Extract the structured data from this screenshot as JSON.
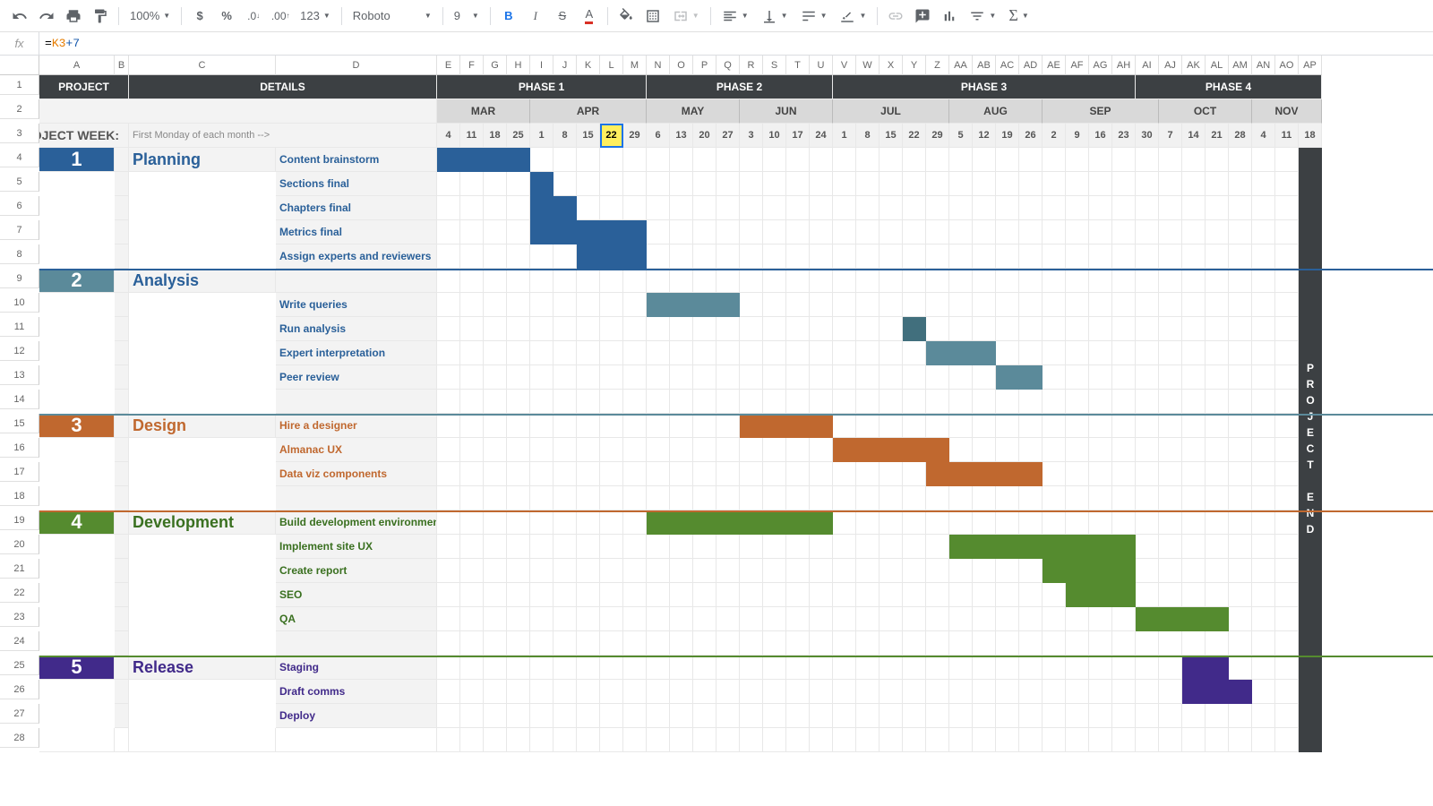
{
  "toolbar": {
    "zoom": "100%",
    "format_options": [
      "$",
      "%",
      ".0",
      ".00",
      "123"
    ],
    "font": "Roboto",
    "font_size": "9"
  },
  "formula": "=K3+7",
  "columns": [
    "A",
    "B",
    "C",
    "D",
    "E",
    "F",
    "G",
    "H",
    "I",
    "J",
    "K",
    "L",
    "M",
    "N",
    "O",
    "P",
    "Q",
    "R",
    "S",
    "T",
    "U",
    "V",
    "W",
    "X",
    "Y",
    "Z",
    "AA",
    "AB",
    "AC",
    "AD",
    "AE",
    "AF",
    "AG",
    "AH",
    "AI",
    "AJ",
    "AK",
    "AL",
    "AM",
    "AN",
    "AO",
    "AP"
  ],
  "headers": {
    "project": "PROJECT",
    "details": "DETAILS",
    "phases": [
      "PHASE 1",
      "PHASE 2",
      "PHASE 3",
      "PHASE 4"
    ],
    "project_week": "PROJECT WEEK:",
    "first_monday": "First Monday of each month -->",
    "project_end": "PROJECT END"
  },
  "months": [
    {
      "name": "MAR",
      "weeks": [
        4,
        11,
        18,
        25
      ]
    },
    {
      "name": "APR",
      "weeks": [
        1,
        8,
        15,
        22,
        29
      ]
    },
    {
      "name": "MAY",
      "weeks": [
        6,
        13,
        20,
        27
      ]
    },
    {
      "name": "JUN",
      "weeks": [
        3,
        10,
        17,
        24
      ]
    },
    {
      "name": "JUL",
      "weeks": [
        1,
        8,
        15,
        22,
        29
      ]
    },
    {
      "name": "AUG",
      "weeks": [
        5,
        12,
        19,
        26
      ]
    },
    {
      "name": "SEP",
      "weeks": [
        2,
        9,
        16,
        23,
        30
      ]
    },
    {
      "name": "OCT",
      "weeks": [
        7,
        14,
        21,
        28
      ]
    },
    {
      "name": "NOV",
      "weeks": [
        4,
        11,
        18
      ]
    }
  ],
  "selected_week_index": 7,
  "sections": [
    {
      "num": "1",
      "name": "Planning",
      "cls": "plan",
      "tasks": [
        {
          "t": "Content brainstorm",
          "s": 0,
          "len": 4
        },
        {
          "t": "Sections final",
          "s": 4,
          "len": 1
        },
        {
          "t": "Chapters final",
          "s": 4,
          "len": 2
        },
        {
          "t": "Metrics final",
          "s": 4,
          "len": 5
        },
        {
          "t": "Assign experts and reviewers",
          "s": 6,
          "len": 3
        }
      ],
      "rows": 5
    },
    {
      "num": "2",
      "name": "Analysis",
      "cls": "anal",
      "tasks": [
        {
          "t": ""
        },
        {
          "t": "Write queries",
          "s": 9,
          "len": 4
        },
        {
          "t": "Run analysis",
          "s": 20,
          "len": 1,
          "dk": true
        },
        {
          "t": "Expert interpretation",
          "s": 21,
          "len": 3
        },
        {
          "t": "Peer review",
          "s": 24,
          "len": 2
        },
        {
          "t": ""
        }
      ],
      "rows": 6
    },
    {
      "num": "3",
      "name": "Design",
      "cls": "des",
      "tasks": [
        {
          "t": "Hire a designer",
          "s": 13,
          "len": 4
        },
        {
          "t": "Almanac UX",
          "s": 17,
          "len": 5
        },
        {
          "t": "Data viz components",
          "s": 21,
          "len": 5
        },
        {
          "t": ""
        }
      ],
      "rows": 4
    },
    {
      "num": "4",
      "name": "Development",
      "cls": "dev",
      "tasks": [
        {
          "t": "Build development environment",
          "s": 9,
          "len": 8
        },
        {
          "t": "Implement site UX",
          "s": 22,
          "len": 8
        },
        {
          "t": "Create report",
          "s": 26,
          "len": 4
        },
        {
          "t": "SEO",
          "s": 27,
          "len": 3
        },
        {
          "t": "QA",
          "s": 30,
          "len": 4
        },
        {
          "t": ""
        }
      ],
      "rows": 6
    },
    {
      "num": "5",
      "name": "Release",
      "cls": "rel",
      "tasks": [
        {
          "t": "Staging",
          "s": 32,
          "len": 2
        },
        {
          "t": "Draft comms",
          "s": 32,
          "len": 3
        },
        {
          "t": "Deploy"
        }
      ],
      "rows": 3
    }
  ]
}
